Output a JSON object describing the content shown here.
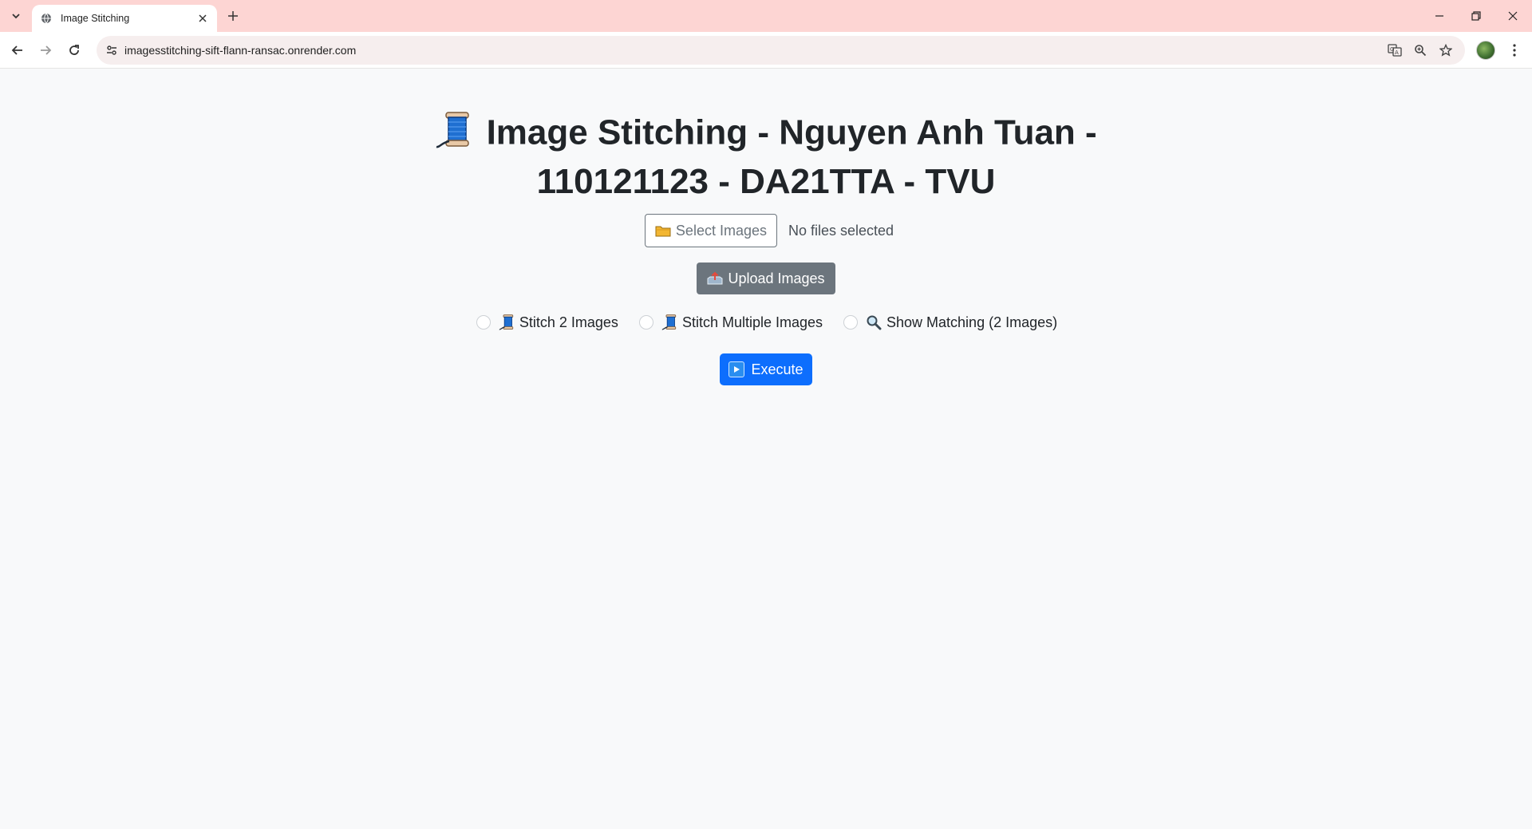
{
  "browser": {
    "tab_title": "Image Stitching",
    "url": "imagesstitching-sift-flann-ransac.onrender.com",
    "colors": {
      "tabbar": "#fdd5d3",
      "omnibox": "#f6eeee"
    }
  },
  "page": {
    "title_line1": "Image Stitching - Nguyen Anh Tuan -",
    "title_line2": "110121123 - DA21TTA - TVU",
    "title_icon": "spool-of-thread-icon",
    "select_button": "Select Images",
    "file_status": "No files selected",
    "upload_button": "Upload Images",
    "options": [
      {
        "label": "Stitch 2 Images",
        "icon": "spool-of-thread-icon",
        "selected": false
      },
      {
        "label": "Stitch Multiple Images",
        "icon": "spool-of-thread-icon",
        "selected": false
      },
      {
        "label": "Show Matching (2 Images)",
        "icon": "magnifier-icon",
        "selected": false
      }
    ],
    "execute_button": "Execute",
    "colors": {
      "primary": "#0d6efd",
      "secondary": "#6c757d",
      "background": "#f8f9fa"
    }
  }
}
